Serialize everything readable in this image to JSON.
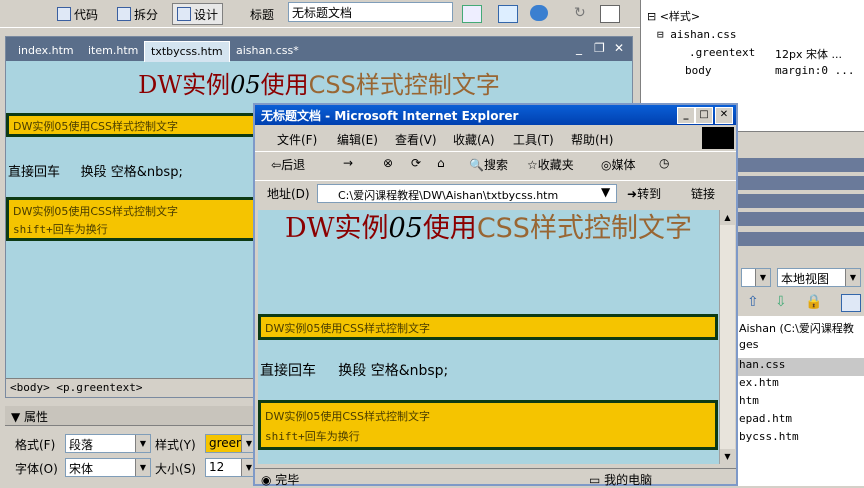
{
  "toolbar": {
    "code_label": "代码",
    "split_label": "拆分",
    "design_label": "设计",
    "title_label": "标题",
    "title_value": "无标题文档"
  },
  "editor": {
    "tabs": [
      "index.htm",
      "item.htm",
      "txtbycss.htm",
      "aishan.css*"
    ],
    "heading_dw": "DW",
    "heading_mid": "实例",
    "heading_num": "05",
    "heading_use": "使用",
    "heading_css": "CSS样式控制文字",
    "box1_text": "DW实例05使用CSS样式控制文字",
    "plain_text": "直接回车     换段 空格&nbsp;",
    "box2_line1": "DW实例05使用CSS样式控制文字",
    "box2_line2": "shift+回车为换行",
    "status": "<body> <p.greentext>"
  },
  "properties": {
    "title": "属性",
    "format_label": "格式(F)",
    "format_value": "段落",
    "style_label": "样式(Y)",
    "style_value": "greente",
    "font_label": "字体(O)",
    "font_value": "宋体",
    "size_label": "大小(S)",
    "size_value": "12"
  },
  "css_panel": {
    "root": "<样式>",
    "file": "aishan.css",
    "rule1_name": ".greentext",
    "rule1_value": "12px 宋体 ...",
    "rule2_name": "body",
    "rule2_value": "margin:0 ..."
  },
  "files_panel": {
    "view_value": "本地视图",
    "items": [
      "Aishan (C:\\爱闪课程教",
      "ges",
      "han.css",
      "ex.htm",
      "htm",
      "epad.htm",
      "bycss.htm"
    ]
  },
  "ie": {
    "title": "无标题文档 - Microsoft Internet Explorer",
    "menu": [
      "文件(F)",
      "编辑(E)",
      "查看(V)",
      "收藏(A)",
      "工具(T)",
      "帮助(H)"
    ],
    "back_label": "后退",
    "search_label": "搜索",
    "favorites_label": "收藏夹",
    "media_label": "媒体",
    "address_label": "地址(D)",
    "address_value": "C:\\爱闪课程教程\\DW\\Aishan\\txtbycss.htm",
    "go_label": "转到",
    "links_label": "链接",
    "heading_dw": "DW",
    "heading_mid": "实例",
    "heading_num": "05",
    "heading_use": "使用",
    "heading_css": "CSS样式控制文字",
    "box1_text": "DW实例05使用CSS样式控制文字",
    "plain_text": "直接回车     换段 空格&nbsp;",
    "box2_line1": "DW实例05使用CSS样式控制文字",
    "box2_line2": "shift+回车为换行",
    "status_done": "完毕",
    "status_zone": "我的电脑"
  },
  "colors": {
    "page_bg": "#aad4e0",
    "box_fill": "#f5c400",
    "box_border": "#0d3a14",
    "css_text": "#996633",
    "dw_text": "#8b0000"
  }
}
